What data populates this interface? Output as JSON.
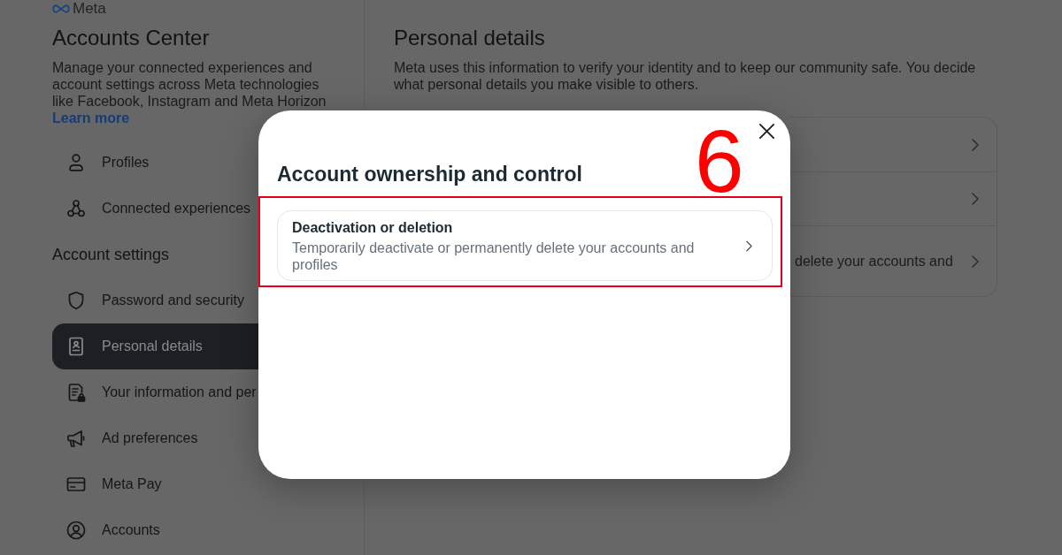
{
  "sidebar": {
    "logo": "Meta",
    "title": "Accounts Center",
    "description": "Manage your connected experiences and account settings across Meta technologies like Facebook, Instagram and Meta Horizon",
    "learn_more": "Learn more",
    "sections": [
      {
        "items": [
          {
            "label": "Profiles",
            "selected": false
          },
          {
            "label": "Connected experiences",
            "selected": false
          }
        ]
      },
      {
        "heading": "Account settings",
        "items": [
          {
            "label": "Password and security",
            "selected": false
          },
          {
            "label": "Personal details",
            "selected": true
          },
          {
            "label": "Your information and per",
            "selected": false
          },
          {
            "label": "Ad preferences",
            "selected": false
          },
          {
            "label": "Meta Pay",
            "selected": false
          },
          {
            "label": "Accounts",
            "selected": false
          }
        ]
      }
    ]
  },
  "main": {
    "title": "Personal details",
    "description": "Meta uses this information to verify your identity and to keep our community safe. You decide what personal details you make visible to others.",
    "rows": [
      {
        "kind": "covered"
      },
      {
        "kind": "covered"
      },
      {
        "kind": "text",
        "text": "delete your accounts and"
      }
    ]
  },
  "modal": {
    "title": "Account ownership and control",
    "options": [
      {
        "title": "Deactivation or deletion",
        "description": "Temporarily deactivate or permanently delete your accounts and profiles",
        "highlighted": true
      }
    ]
  },
  "annotation": {
    "step": "6"
  }
}
